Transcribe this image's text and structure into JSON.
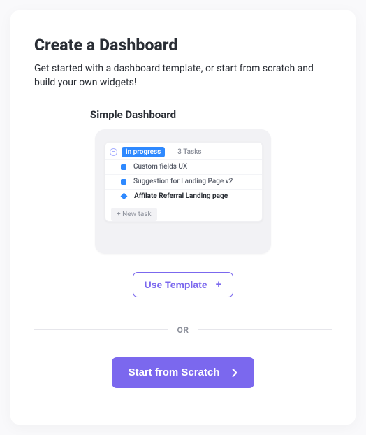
{
  "header": {
    "title": "Create a Dashboard",
    "subtitle": "Get started with a dashboard template, or start from scratch and build your own widgets!"
  },
  "template": {
    "name": "Simple Dashboard",
    "preview": {
      "status_label": "in progress",
      "task_count": "3 Tasks",
      "tasks": [
        {
          "text": "Custom fields UX",
          "bold": false,
          "icon": "square"
        },
        {
          "text": "Suggestion for Landing Page v2",
          "bold": false,
          "icon": "square"
        },
        {
          "text": "Affilate Referral Landing page",
          "bold": true,
          "icon": "diamond"
        }
      ],
      "new_task_label": "+ New task"
    },
    "use_button_label": "Use Template"
  },
  "divider": {
    "label": "OR"
  },
  "scratch": {
    "label": "Start from Scratch"
  }
}
